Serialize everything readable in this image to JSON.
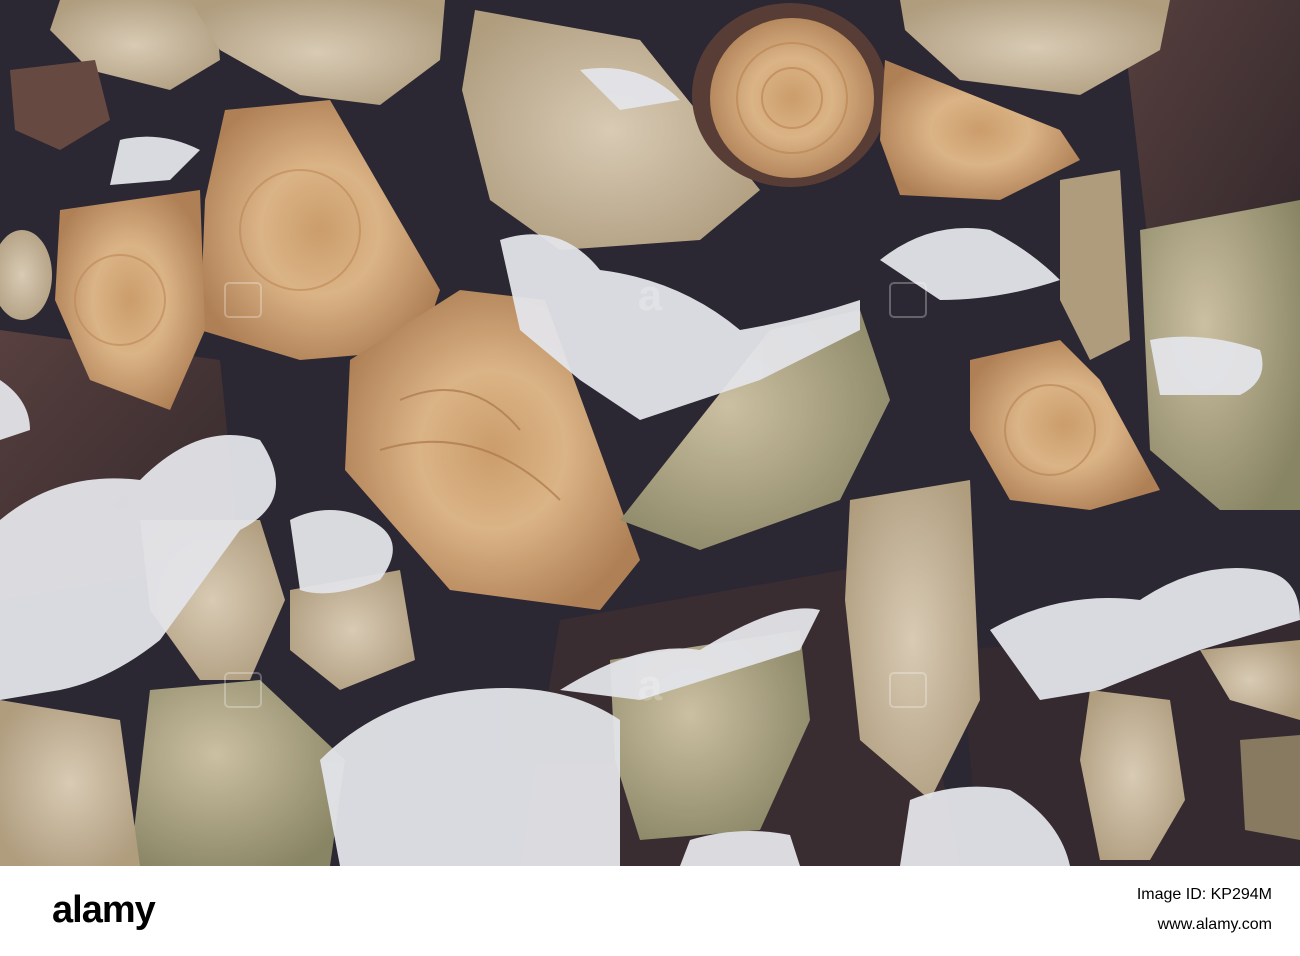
{
  "photo": {
    "subject": "stacked firewood logs with snow",
    "colors": {
      "background": "#2b2530",
      "wood_light": "#d9c6a8",
      "wood_warm": "#c9935f",
      "bark": "#4a3535",
      "snow": "#f2f2f6"
    }
  },
  "watermark": {
    "brand": "alamy"
  },
  "footer": {
    "logo_text": "alamy",
    "watermark_brand": "alamy",
    "image_id_label": "Image ID: KP294M",
    "site": "www.alamy.com"
  }
}
